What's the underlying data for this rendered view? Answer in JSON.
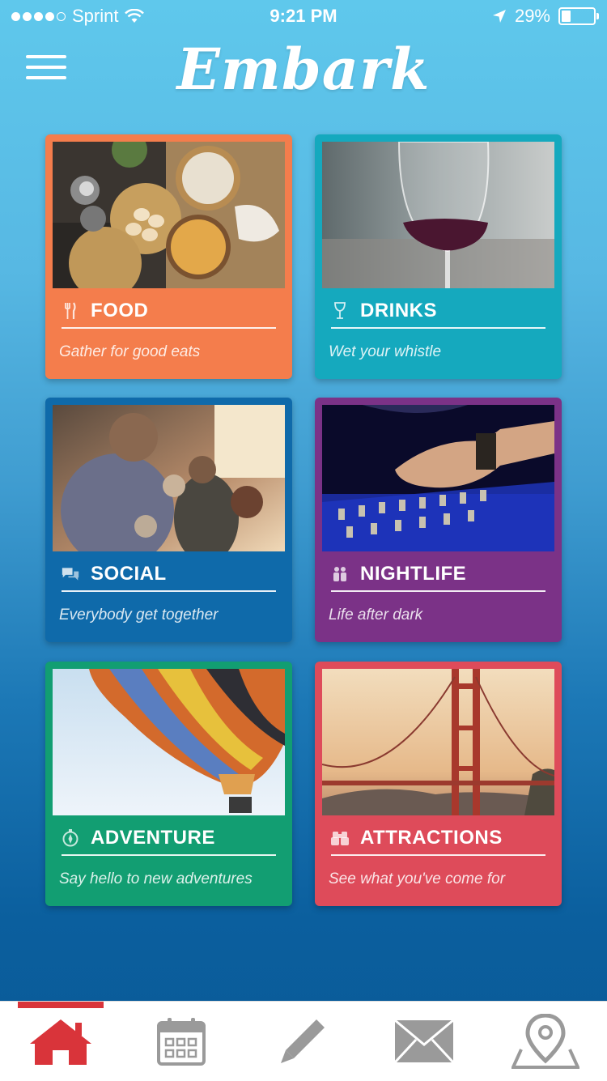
{
  "status": {
    "carrier": "Sprint",
    "time": "9:21 PM",
    "battery": "29%",
    "battery_level": 0.29
  },
  "header": {
    "title": "Embark"
  },
  "categories": [
    {
      "name": "FOOD",
      "tagline": "Gather for good eats",
      "color": "#f47d4c",
      "icon": "fork-knife-icon",
      "photo": "food-photo"
    },
    {
      "name": "DRINKS",
      "tagline": "Wet your whistle",
      "color": "#15a9be",
      "icon": "wine-glass-icon",
      "photo": "wine-glass-photo"
    },
    {
      "name": "SOCIAL",
      "tagline": "Everybody get together",
      "color": "#0f6aaa",
      "icon": "chat-bubbles-icon",
      "photo": "crowd-photo"
    },
    {
      "name": "NIGHTLIFE",
      "tagline": "Life after dark",
      "color": "#7b3287",
      "icon": "people-icon",
      "photo": "dj-mixer-photo"
    },
    {
      "name": "ADVENTURE",
      "tagline": "Say hello to new adventures",
      "color": "#129e72",
      "icon": "compass-icon",
      "photo": "hot-air-balloon-photo"
    },
    {
      "name": "ATTRACTIONS",
      "tagline": "See what you've come for",
      "color": "#de4b5a",
      "icon": "binoculars-icon",
      "photo": "golden-gate-bridge-photo"
    }
  ],
  "tabbar": {
    "active_color": "#d9343a",
    "inactive_color": "#9a9a9a",
    "tabs": [
      "home-icon",
      "calendar-icon",
      "pencil-icon",
      "mail-icon",
      "map-pin-icon"
    ],
    "active_tab": "home-icon"
  }
}
